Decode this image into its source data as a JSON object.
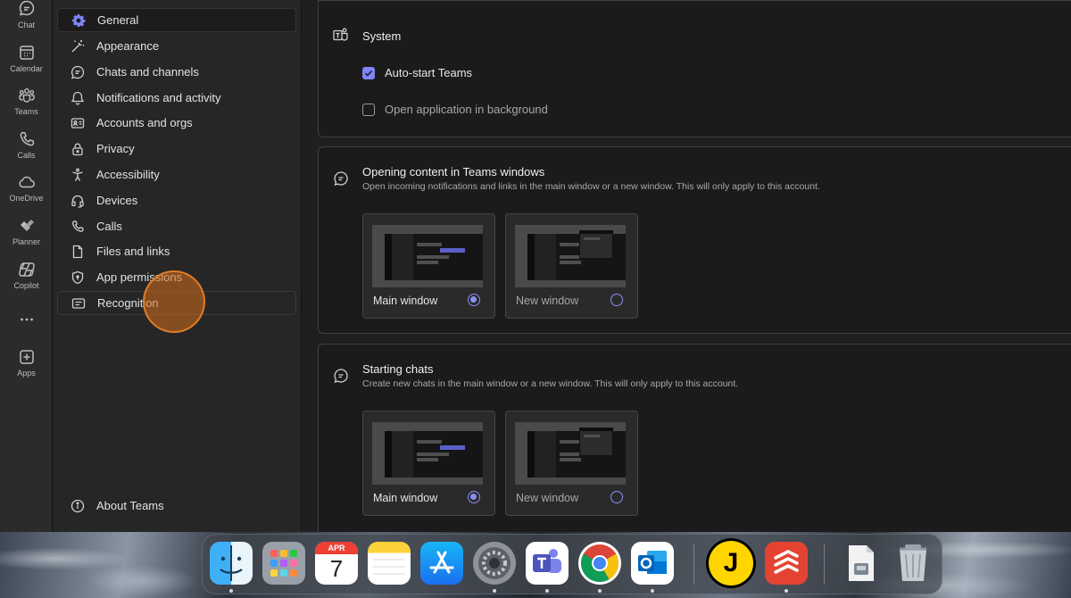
{
  "app_rail": [
    {
      "id": "chat",
      "label": "Chat",
      "icon": "chat-icon"
    },
    {
      "id": "calendar",
      "label": "Calendar",
      "icon": "calendar-icon"
    },
    {
      "id": "teams",
      "label": "Teams",
      "icon": "teams-icon"
    },
    {
      "id": "calls",
      "label": "Calls",
      "icon": "phone-icon"
    },
    {
      "id": "onedrive",
      "label": "OneDrive",
      "icon": "cloud-icon"
    },
    {
      "id": "planner",
      "label": "Planner",
      "icon": "planner-icon"
    },
    {
      "id": "copilot",
      "label": "Copilot",
      "icon": "copilot-icon"
    },
    {
      "id": "more",
      "label": "",
      "icon": "more-icon"
    },
    {
      "id": "apps",
      "label": "Apps",
      "icon": "add-apps-icon"
    }
  ],
  "settings_nav": {
    "items": [
      {
        "label": "General",
        "icon": "gear-icon",
        "selected": true
      },
      {
        "label": "Appearance",
        "icon": "magic-wand-icon"
      },
      {
        "label": "Chats and channels",
        "icon": "chat-icon"
      },
      {
        "label": "Notifications and activity",
        "icon": "bell-icon"
      },
      {
        "label": "Accounts and orgs",
        "icon": "id-card-icon"
      },
      {
        "label": "Privacy",
        "icon": "lock-icon"
      },
      {
        "label": "Accessibility",
        "icon": "accessibility-icon"
      },
      {
        "label": "Devices",
        "icon": "headset-icon"
      },
      {
        "label": "Calls",
        "icon": "phone-icon"
      },
      {
        "label": "Files and links",
        "icon": "file-icon"
      },
      {
        "label": "App permissions",
        "icon": "shield-icon"
      },
      {
        "label": "Recognition",
        "icon": "recognition-icon",
        "hovered": true
      }
    ],
    "about_label": "About Teams"
  },
  "content": {
    "system": {
      "title": "System",
      "options": [
        {
          "label": "Auto-start Teams",
          "checked": true
        },
        {
          "label": "Open application in background",
          "checked": false
        }
      ]
    },
    "opening_content": {
      "title": "Opening content in Teams windows",
      "description": "Open incoming notifications and links in the main window or a new window. This will only apply to this account.",
      "choices": [
        {
          "label": "Main window",
          "selected": true
        },
        {
          "label": "New window",
          "selected": false
        }
      ]
    },
    "starting_chats": {
      "title": "Starting chats",
      "description": "Create new chats in the main window or a new window. This will only apply to this account.",
      "choices": [
        {
          "label": "Main window",
          "selected": true
        },
        {
          "label": "New window",
          "selected": false
        }
      ]
    }
  },
  "dock": {
    "apps": [
      {
        "name": "Finder",
        "icon": "finder-icon",
        "running": true
      },
      {
        "name": "Launchpad",
        "icon": "launchpad-icon",
        "running": false
      },
      {
        "name": "Calendar",
        "icon": "calendar-app-icon",
        "running": false,
        "month": "APR",
        "day": "7"
      },
      {
        "name": "Notes",
        "icon": "notes-icon",
        "running": false
      },
      {
        "name": "App Store",
        "icon": "app-store-icon",
        "running": false
      },
      {
        "name": "System Settings",
        "icon": "settings-icon",
        "running": true
      },
      {
        "name": "Microsoft Teams",
        "icon": "teams-app-icon",
        "running": true
      },
      {
        "name": "Google Chrome",
        "icon": "chrome-icon",
        "running": true
      },
      {
        "name": "Microsoft Outlook",
        "icon": "outlook-icon",
        "running": true
      },
      {
        "name": "J",
        "icon": "j-app-icon",
        "running": false,
        "letter": "J"
      },
      {
        "name": "Todoist",
        "icon": "todoist-icon",
        "running": true
      },
      {
        "name": "Disk image",
        "icon": "disk-image-icon",
        "running": false
      },
      {
        "name": "Trash",
        "icon": "trash-icon",
        "running": false
      }
    ]
  },
  "colors": {
    "accent": "#7f85f5",
    "click_indicator": "#d6701c"
  }
}
